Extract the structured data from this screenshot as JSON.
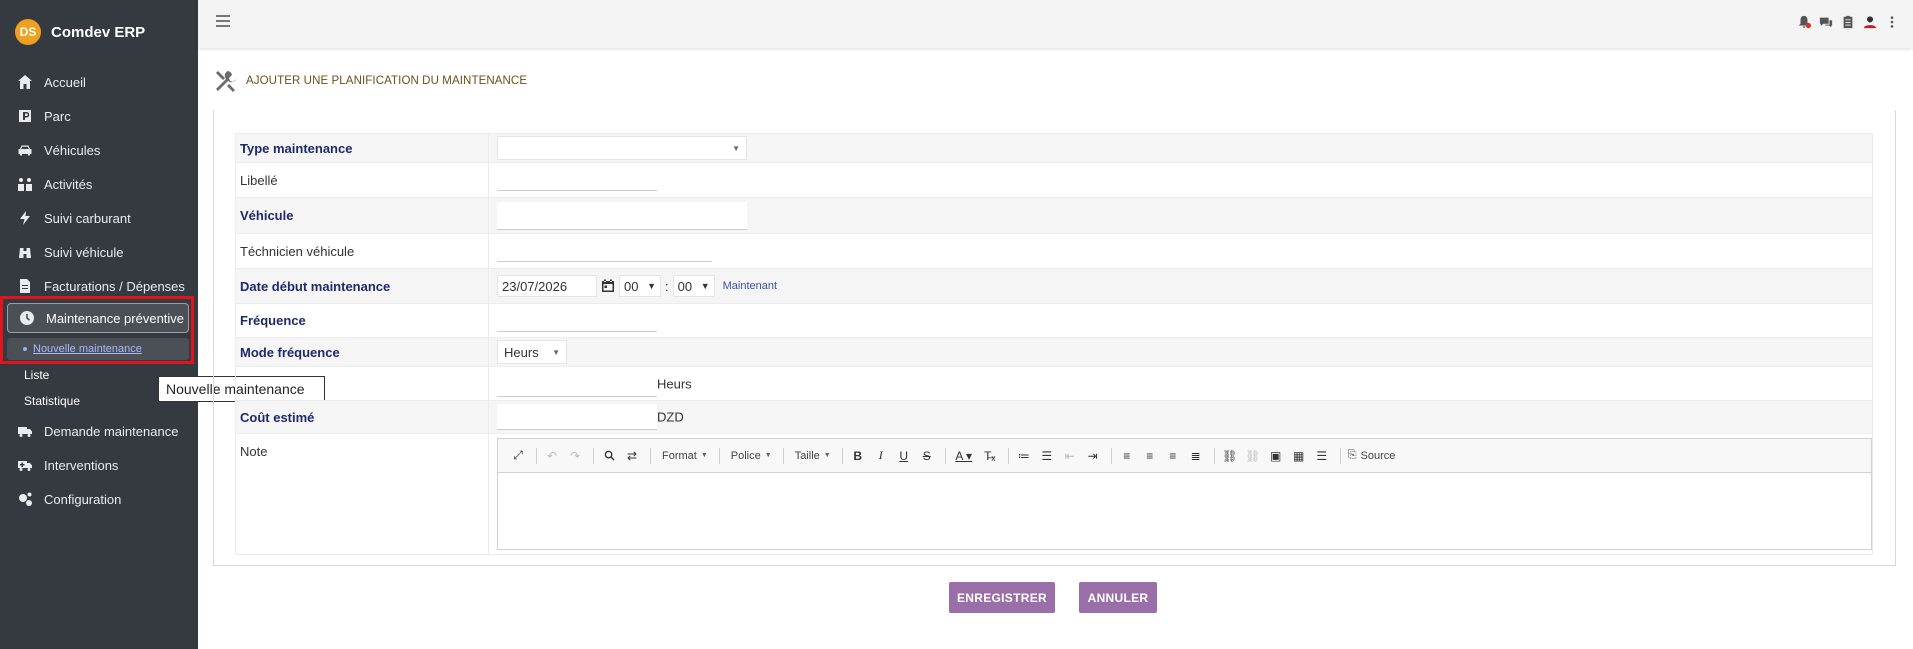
{
  "app": {
    "name": "Comdev ERP",
    "logo_text": "DS"
  },
  "sidebar": {
    "items": [
      {
        "label": "Accueil",
        "icon": "home-icon"
      },
      {
        "label": "Parc",
        "icon": "parking-icon"
      },
      {
        "label": "Véhicules",
        "icon": "car-icon"
      },
      {
        "label": "Activités",
        "icon": "activities-icon"
      },
      {
        "label": "Suivi carburant",
        "icon": "bolt-icon"
      },
      {
        "label": "Suivi véhicule",
        "icon": "binoculars-icon"
      },
      {
        "label": "Facturations / Dépenses",
        "icon": "invoice-icon"
      },
      {
        "label": "Maintenance préventive",
        "icon": "clock-icon"
      },
      {
        "label": "Demande maintenance",
        "icon": "truck-icon"
      },
      {
        "label": "Interventions",
        "icon": "ambulance-icon"
      },
      {
        "label": "Configuration",
        "icon": "gears-icon"
      }
    ],
    "sub_items": [
      {
        "label": "Nouvelle maintenance"
      },
      {
        "label": "Liste"
      },
      {
        "label": "Statistique"
      }
    ]
  },
  "tooltip": {
    "text": "Nouvelle maintenance"
  },
  "page": {
    "title": "AJOUTER UNE PLANIFICATION DU MAINTENANCE"
  },
  "form": {
    "type_maintenance": {
      "label": "Type maintenance",
      "value": ""
    },
    "libelle": {
      "label": "Libellé",
      "value": ""
    },
    "vehicule": {
      "label": "Véhicule",
      "value": ""
    },
    "technicien": {
      "label": "Téchnicien véhicule",
      "value": ""
    },
    "date_debut": {
      "label": "Date début maintenance",
      "date": "23/07/2026",
      "hour": "00",
      "minute": "00",
      "separator": ":",
      "now_label": "Maintenant"
    },
    "frequence": {
      "label": "Fréquence",
      "value": ""
    },
    "mode_frequence": {
      "label": "Mode fréquence",
      "value": "Heurs"
    },
    "heurs_row": {
      "label": "",
      "value": "",
      "unit": "Heurs"
    },
    "cout": {
      "label": "Coût estimé",
      "value": "",
      "unit": "DZD"
    },
    "note": {
      "label": "Note"
    }
  },
  "editor": {
    "format_label": "Format",
    "police_label": "Police",
    "taille_label": "Taille",
    "source_label": "Source"
  },
  "buttons": {
    "save": "ENREGISTRER",
    "cancel": "ANNULER"
  },
  "colors": {
    "sidebar_bg": "#343a40",
    "button_bg": "#9a6ea9",
    "highlight": "#e0151b",
    "label_bold": "#1d2a6b"
  }
}
